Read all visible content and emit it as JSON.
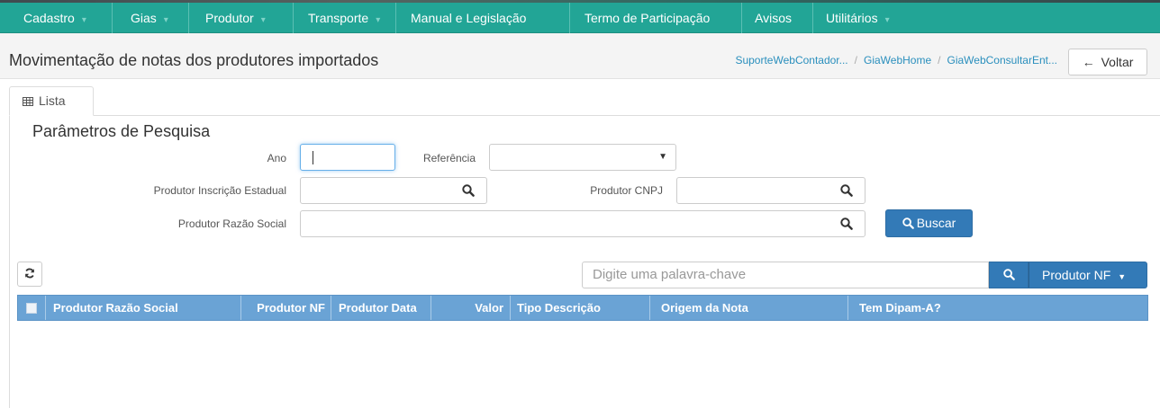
{
  "nav": {
    "items": [
      {
        "label": "Cadastro",
        "caret": true
      },
      {
        "label": "Gias",
        "caret": true
      },
      {
        "label": "Produtor",
        "caret": true
      },
      {
        "label": "Transporte",
        "caret": true
      },
      {
        "label": "Manual e Legislação",
        "caret": false
      },
      {
        "label": "Termo de Participação",
        "caret": false
      },
      {
        "label": "Avisos",
        "caret": false
      },
      {
        "label": "Utilitários",
        "caret": true
      }
    ]
  },
  "header": {
    "title": "Movimentação de notas dos produtores importados",
    "breadcrumb": [
      "SuporteWebContador...",
      "GiaWebHome",
      "GiaWebConsultarEnt..."
    ],
    "back_label": "Voltar"
  },
  "tab": {
    "label": "Lista"
  },
  "search_form": {
    "title": "Parâmetros de Pesquisa",
    "ano_label": "Ano",
    "ano_value": "",
    "referencia_label": "Referência",
    "referencia_value": "",
    "ie_label": "Produtor Inscrição Estadual",
    "cnpj_label": "Produtor CNPJ",
    "razao_label": "Produtor Razão Social",
    "buscar_label": "Buscar"
  },
  "grid": {
    "keyword_placeholder": "Digite uma palavra-chave",
    "column_selector": "Produtor NF",
    "columns": [
      "Produtor Razão Social",
      "Produtor NF",
      "Produtor Data",
      "Valor",
      "Tipo Descrição",
      "Origem da Nota",
      "Tem Dipam-A?"
    ]
  },
  "colors": {
    "navbar": "#22a596",
    "primary": "#337ab7",
    "grid_header": "#6aa3d5"
  }
}
